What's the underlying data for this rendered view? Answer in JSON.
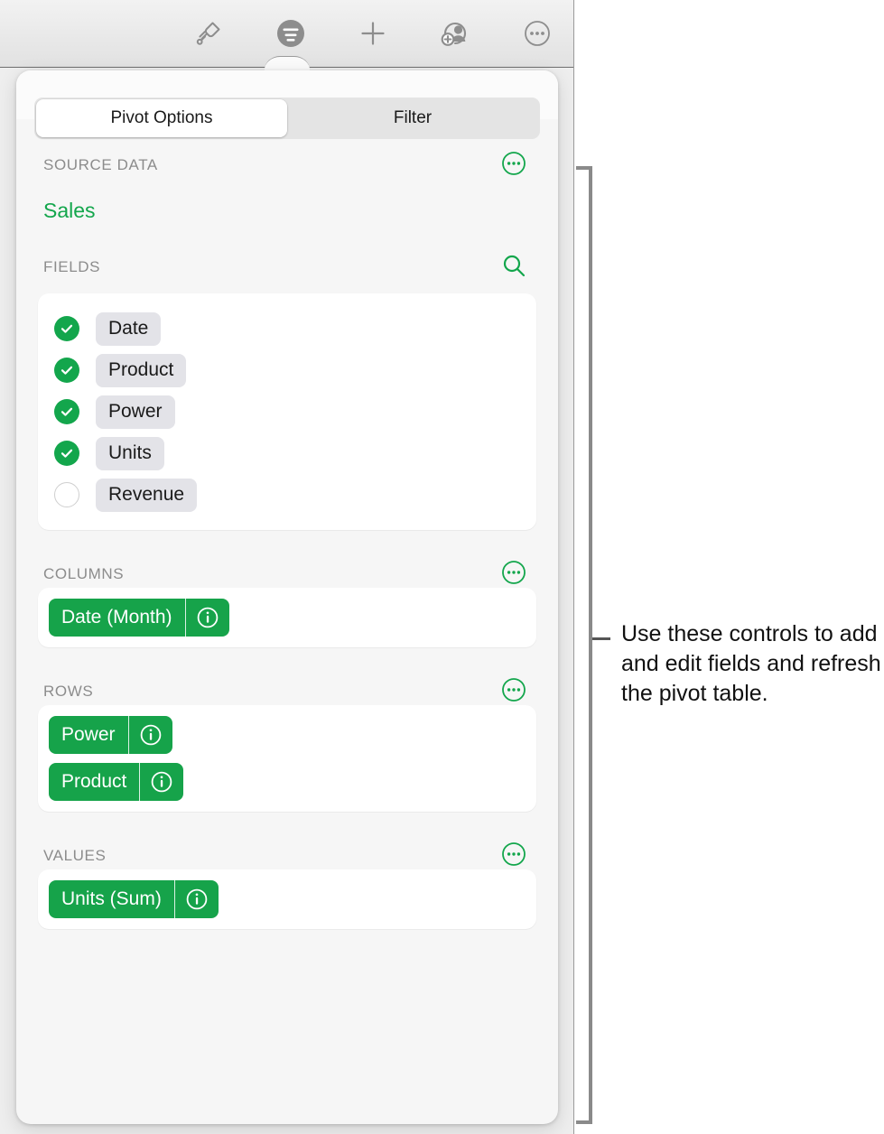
{
  "toolbar": {
    "buttons": [
      {
        "name": "format-brush-icon",
        "label": "Format"
      },
      {
        "name": "pivot-options-icon",
        "label": "Pivot Options"
      },
      {
        "name": "insert-icon",
        "label": "Insert"
      },
      {
        "name": "collaborate-icon",
        "label": "Collaborate"
      },
      {
        "name": "more-icon",
        "label": "More"
      }
    ]
  },
  "popover": {
    "tabs": [
      {
        "label": "Pivot Options",
        "active": true
      },
      {
        "label": "Filter",
        "active": false
      }
    ],
    "source_data": {
      "header": "SOURCE DATA",
      "menu_icon": "ellipsis-circle-icon",
      "name": "Sales"
    },
    "fields": {
      "header": "FIELDS",
      "search_icon": "search-icon",
      "items": [
        {
          "label": "Date",
          "checked": true
        },
        {
          "label": "Product",
          "checked": true
        },
        {
          "label": "Power",
          "checked": true
        },
        {
          "label": "Units",
          "checked": true
        },
        {
          "label": "Revenue",
          "checked": false
        }
      ]
    },
    "columns": {
      "header": "COLUMNS",
      "menu_icon": "ellipsis-circle-icon",
      "tokens": [
        {
          "label": "Date (Month)",
          "info_icon": "info-circle-icon"
        }
      ]
    },
    "rows": {
      "header": "ROWS",
      "menu_icon": "ellipsis-circle-icon",
      "tokens": [
        {
          "label": "Power",
          "info_icon": "info-circle-icon"
        },
        {
          "label": "Product",
          "info_icon": "info-circle-icon"
        }
      ]
    },
    "values": {
      "header": "VALUES",
      "menu_icon": "ellipsis-circle-icon",
      "tokens": [
        {
          "label": "Units (Sum)",
          "info_icon": "info-circle-icon"
        }
      ]
    }
  },
  "callout": {
    "text": "Use these controls to add and edit fields and refresh the pivot table."
  },
  "colors": {
    "accent_green": "#13a64c",
    "token_green": "#16a34a",
    "chip_gray": "#e3e3e8",
    "label_gray": "#8c8c8c"
  }
}
